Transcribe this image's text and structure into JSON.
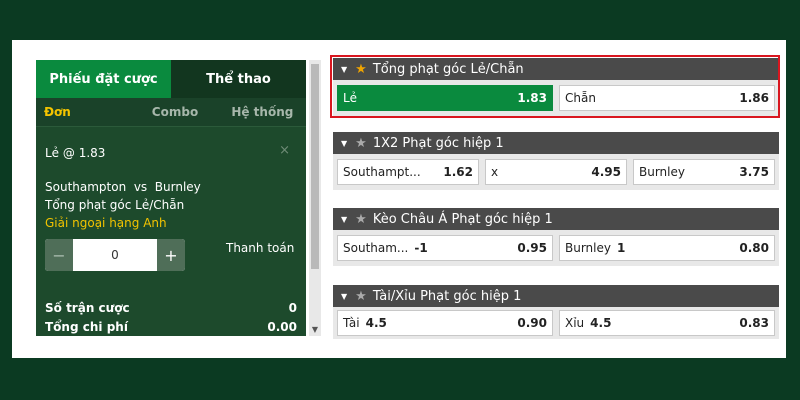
{
  "colors": {
    "accent": "#0a8a3e",
    "highlight": "#d9161f",
    "star": "#f0a400"
  },
  "slip": {
    "tabs": [
      "Phiếu đặt cược",
      "Thể thao"
    ],
    "sub_tabs": [
      "Đơn",
      "Combo",
      "Hệ thống"
    ],
    "selection": "Lẻ @ 1.83",
    "close_glyph": "×",
    "match": "Southampton  vs  Burnley",
    "market": "Tổng phạt góc Lẻ/Chẵn",
    "league": "Giải ngoại hạng Anh",
    "stake": {
      "minus": "−",
      "value": "0",
      "plus": "+"
    },
    "pay_label": "Thanh toán",
    "summary": [
      {
        "label": "Số trận cược",
        "value": "0"
      },
      {
        "label": "Tổng chi phí",
        "value": "0.00"
      }
    ]
  },
  "markets": [
    {
      "title": "Tổng phạt góc Lẻ/Chẵn",
      "favorite": true,
      "options": [
        {
          "label": "Lẻ",
          "handicap": "",
          "odds": "1.83",
          "selected": true
        },
        {
          "label": "Chẵn",
          "handicap": "",
          "odds": "1.86",
          "selected": false
        }
      ]
    },
    {
      "title": "1X2 Phạt góc hiệp 1",
      "favorite": false,
      "options": [
        {
          "label": "Southampt...",
          "handicap": "",
          "odds": "1.62",
          "selected": false
        },
        {
          "label": "x",
          "handicap": "",
          "odds": "4.95",
          "selected": false
        },
        {
          "label": "Burnley",
          "handicap": "",
          "odds": "3.75",
          "selected": false
        }
      ]
    },
    {
      "title": "Kèo Châu Á Phạt góc hiệp 1",
      "favorite": false,
      "options": [
        {
          "label": "Southam...",
          "handicap": "-1",
          "odds": "0.95",
          "selected": false
        },
        {
          "label": "Burnley",
          "handicap": "1",
          "odds": "0.80",
          "selected": false
        }
      ]
    },
    {
      "title": "Tài/Xỉu Phạt góc hiệp 1",
      "favorite": false,
      "options": [
        {
          "label": "Tài",
          "handicap": "4.5",
          "odds": "0.90",
          "selected": false
        },
        {
          "label": "Xỉu",
          "handicap": "4.5",
          "odds": "0.83",
          "selected": false
        }
      ]
    }
  ]
}
